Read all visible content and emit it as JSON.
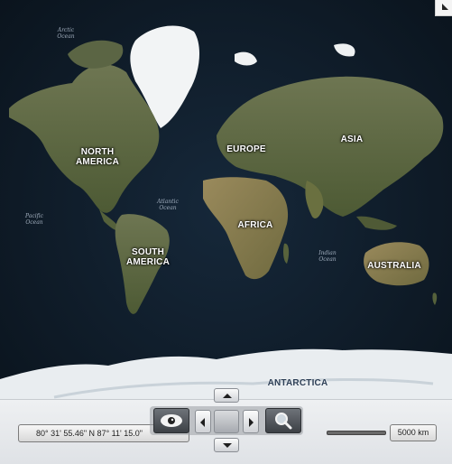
{
  "map": {
    "continents": [
      "NORTH\nAMERICA",
      "EUROPE",
      "ASIA",
      "AFRICA",
      "SOUTH\nAMERICA",
      "AUSTRALIA",
      "ANTARCTICA"
    ],
    "oceans": [
      "Arctic\nOcean",
      "Atlantic\nOcean",
      "Pacific\nOcean",
      "Indian\nOcean"
    ]
  },
  "status": {
    "coordinates": "80° 31' 55.46\" N 87° 11' 15.0\"",
    "scale_label": "5000 km"
  },
  "icons": {
    "corner": "corner-resize-icon",
    "eye": "eye-icon",
    "zoom": "magnifier-icon",
    "pan_up": "arrow-up-icon",
    "pan_down": "arrow-down-icon",
    "pan_left": "arrow-left-icon",
    "pan_right": "arrow-right-icon"
  },
  "colors": {
    "ocean": "#12202d",
    "land": "#5f6a44",
    "ice": "#e8ecef"
  }
}
